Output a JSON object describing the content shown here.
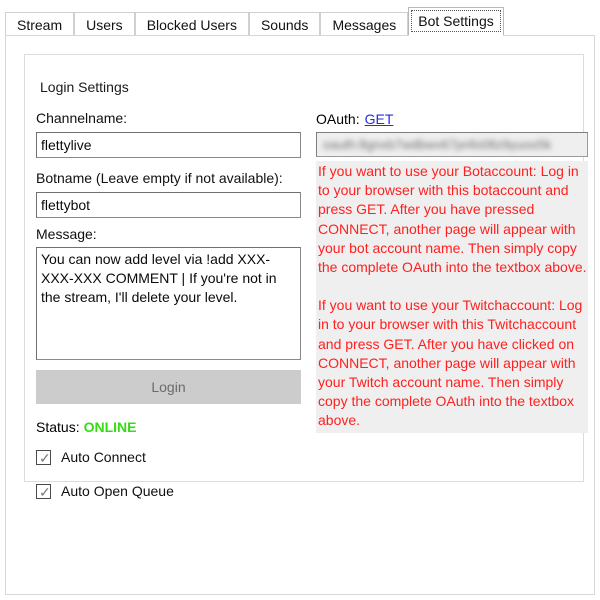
{
  "window": {
    "tabs": [
      {
        "label": "Stream",
        "active": false
      },
      {
        "label": "Users",
        "active": false
      },
      {
        "label": "Blocked Users",
        "active": false
      },
      {
        "label": "Sounds",
        "active": false
      },
      {
        "label": "Messages",
        "active": false
      },
      {
        "label": "Bot Settings",
        "active": true
      }
    ]
  },
  "login_settings": {
    "group_title": "Login Settings",
    "channelname": {
      "label": "Channelname:",
      "value": "flettylive",
      "placeholder": ""
    },
    "botname": {
      "label": "Botname (Leave empty if not available):",
      "value": "flettybot",
      "placeholder": ""
    },
    "message": {
      "label": "Message:",
      "value": "You can now add level via !add XXX-XXX-XXX COMMENT | If you're not in the stream, I'll delete your level.",
      "placeholder": ""
    },
    "login_button": {
      "label": "Login",
      "enabled": false
    },
    "status": {
      "label": "Status:",
      "value": "ONLINE",
      "color": "#33dd11"
    },
    "checkboxes": [
      {
        "label": "Auto Connect",
        "checked": true,
        "mark": "✓"
      },
      {
        "label": "Auto Open Queue",
        "checked": true,
        "mark": "✓"
      }
    ]
  },
  "oauth": {
    "label": "OAuth:",
    "get_link": "GET",
    "get_link_color": "#2a2ae0",
    "token_value": "oauth:8gnxb7wdbwv67pnfo08z9yuoo5k",
    "token_is_masked": true,
    "help_color": "#ff2020",
    "help_paragraph_1": "If you want to use your Botaccount: Log in to your browser with this botaccount and press GET. After you have pressed CONNECT, another page will appear with your bot account name. Then simply copy the complete OAuth into the textbox above.",
    "help_paragraph_2": "If you want to use your Twitchaccount: Log in to your browser with this Twitchaccount and press GET. After you have clicked on CONNECT, another page will appear with your Twitch account name. Then simply copy the complete OAuth into the textbox above."
  }
}
